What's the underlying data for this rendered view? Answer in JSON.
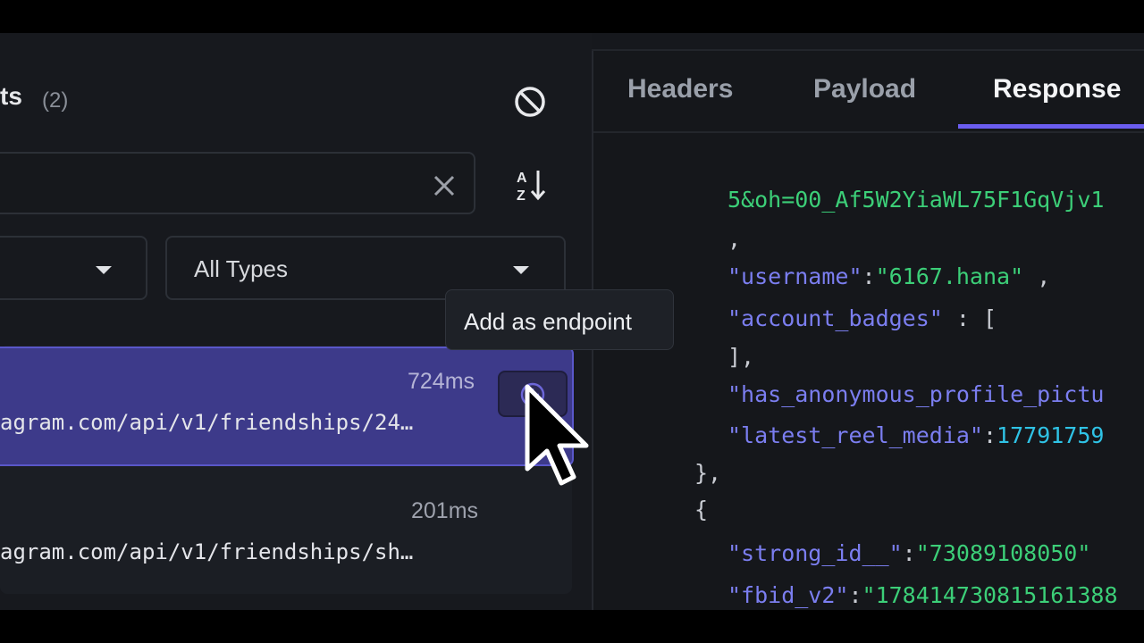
{
  "panel": {
    "title": "ts",
    "count": "(2)"
  },
  "filters": {
    "type_select": "All Types"
  },
  "tooltip": "Add as endpoint",
  "requests": [
    {
      "time": "724ms",
      "url": "agram.com/api/v1/friendships/24…"
    },
    {
      "time": "201ms",
      "url": "agram.com/api/v1/friendships/sh…"
    }
  ],
  "tabs": {
    "headers": "Headers",
    "payload": "Payload",
    "response": "Response"
  },
  "response": {
    "line_url_tail": "5&oh=00_Af5W2YiaWL75F1GqVjv1",
    "comma1": ",",
    "username_key": "\"username\"",
    "username_value": "\"6167.hana\"",
    "account_badges_key": "\"account_badges\"",
    "open_bracket": "[",
    "close_bracket": "],",
    "anon_key": "\"has_anonymous_profile_pictu",
    "latest_key": "\"latest_reel_media\"",
    "latest_value": "17791759",
    "close_brace": "},",
    "open_brace": "{",
    "strong_key": "\"strong_id__\"",
    "strong_value": "\"73089108050\"",
    "fbid_key": "\"fbid_v2\"",
    "fbid_value": "\"178414730815161388"
  },
  "colors": {
    "accent": "#6b5df0",
    "selected_row": "#3d3a8a",
    "json_key": "#7b7ef0",
    "json_string": "#3ccf78",
    "json_number": "#2fc3e6"
  },
  "icons": [
    "clear-all-icon",
    "close-icon",
    "sort-az-icon",
    "chevron-down-icon",
    "add-circle-icon",
    "mouse-pointer-icon"
  ]
}
